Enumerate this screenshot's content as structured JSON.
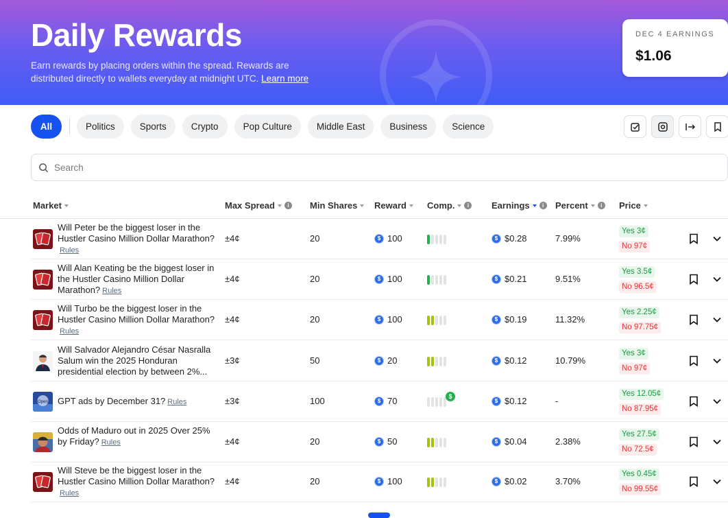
{
  "hero": {
    "title": "Daily Rewards",
    "subtitle": "Earn rewards by placing orders within the spread. Rewards are distributed directly to wallets everyday at midnight UTC.",
    "learn_more": "Learn more",
    "earnings_label": "DEC 4 EARNINGS",
    "earnings_value": "$1.06"
  },
  "filters": [
    "All",
    "Politics",
    "Sports",
    "Crypto",
    "Pop Culture",
    "Middle East",
    "Business",
    "Science"
  ],
  "active_filter": "All",
  "search": {
    "placeholder": "Search"
  },
  "columns": {
    "market": "Market",
    "max_spread": "Max Spread",
    "min_shares": "Min Shares",
    "reward": "Reward",
    "comp": "Comp.",
    "earnings": "Earnings",
    "percent": "Percent",
    "price": "Price"
  },
  "rows": [
    {
      "market": "Will Peter be the biggest loser in the Hustler Casino Million Dollar Marathon?",
      "rules": "Rules",
      "thumb": "casino-cards",
      "spread": "±4¢",
      "shares": "20",
      "reward": "100",
      "comp": 1,
      "comp_color": "green",
      "earnings": "$0.28",
      "percent": "7.99%",
      "yes": "Yes 3¢",
      "no": "No 97¢"
    },
    {
      "market": "Will Alan Keating be the biggest loser in the Hustler Casino Million Dollar Marathon?",
      "rules": "Rules",
      "thumb": "casino-cards",
      "spread": "±4¢",
      "shares": "20",
      "reward": "100",
      "comp": 1,
      "comp_color": "green",
      "earnings": "$0.21",
      "percent": "9.51%",
      "yes": "Yes 3.5¢",
      "no": "No 96.5¢"
    },
    {
      "market": "Will Turbo be the biggest loser in the Hustler Casino Million Dollar Marathon?",
      "rules": "Rules",
      "thumb": "casino-cards",
      "spread": "±4¢",
      "shares": "20",
      "reward": "100",
      "comp": 2,
      "comp_color": "yellow",
      "earnings": "$0.19",
      "percent": "11.32%",
      "yes": "Yes 2.25¢",
      "no": "No 97.75¢"
    },
    {
      "market": "Will Salvador Alejandro César Nasralla Salum win the 2025 Honduran presidential election by between 2%...",
      "rules": "",
      "thumb": "portrait",
      "spread": "±3¢",
      "shares": "50",
      "reward": "20",
      "comp": 2,
      "comp_color": "yellow",
      "earnings": "$0.12",
      "percent": "10.79%",
      "yes": "Yes 3¢",
      "no": "No 97¢"
    },
    {
      "market": "GPT ads by December 31?",
      "rules": "Rules",
      "thumb": "openai",
      "spread": "±3¢",
      "shares": "100",
      "reward": "70",
      "comp": 0,
      "comp_color": "none",
      "earnings": "$0.12",
      "percent": "-",
      "yes": "Yes 12.05¢",
      "no": "No 87.95¢"
    },
    {
      "market": "Odds of Maduro out in 2025 Over 25% by Friday?",
      "rules": "Rules",
      "thumb": "maduro",
      "spread": "±4¢",
      "shares": "20",
      "reward": "50",
      "comp": 2,
      "comp_color": "yellow",
      "earnings": "$0.04",
      "percent": "2.38%",
      "yes": "Yes 27.5¢",
      "no": "No 72.5¢"
    },
    {
      "market": "Will Steve be the biggest loser in the Hustler Casino Million Dollar Marathon?",
      "rules": "Rules",
      "thumb": "casino-cards",
      "spread": "±4¢",
      "shares": "20",
      "reward": "100",
      "comp": 2,
      "comp_color": "yellow",
      "earnings": "$0.02",
      "percent": "3.70%",
      "yes": "Yes 0.45¢",
      "no": "No 99.55¢"
    }
  ]
}
